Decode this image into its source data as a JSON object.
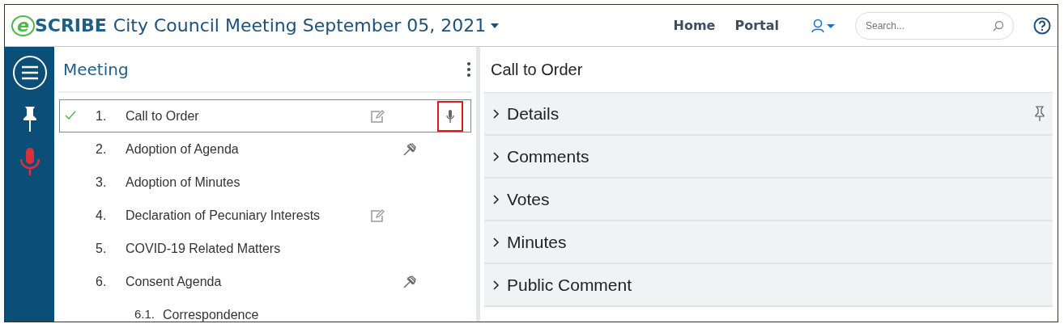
{
  "header": {
    "logo_mark": "e",
    "logo_text": "SCRIBE",
    "title": "City Council Meeting September 05, 2021",
    "nav": [
      "Home",
      "Portal"
    ],
    "search": {
      "placeholder": "Search..."
    }
  },
  "sidebar": {
    "items": [
      {
        "kind": "menu"
      },
      {
        "kind": "pin"
      },
      {
        "kind": "mic"
      }
    ]
  },
  "agenda": {
    "title": "Meeting",
    "items": [
      {
        "number": "1.",
        "title": "Call to Order",
        "checked": true,
        "selected": true,
        "notes": true,
        "motion": false,
        "recording": true
      },
      {
        "number": "2.",
        "title": "Adoption of Agenda",
        "checked": false,
        "selected": false,
        "notes": false,
        "motion": true,
        "recording": false
      },
      {
        "number": "3.",
        "title": "Adoption of Minutes",
        "checked": false,
        "selected": false,
        "notes": false,
        "motion": false,
        "recording": false
      },
      {
        "number": "4.",
        "title": "Declaration of Pecuniary Interests",
        "checked": false,
        "selected": false,
        "notes": true,
        "motion": false,
        "recording": false
      },
      {
        "number": "5.",
        "title": "COVID-19 Related Matters",
        "checked": false,
        "selected": false,
        "notes": false,
        "motion": false,
        "recording": false
      },
      {
        "number": "6.",
        "title": "Consent Agenda",
        "checked": false,
        "selected": false,
        "notes": false,
        "motion": true,
        "recording": false,
        "children": [
          {
            "number": "6.1.",
            "title": "Correspondence",
            "selected": false
          }
        ]
      }
    ]
  },
  "detail": {
    "title": "Call to Order",
    "sections": [
      {
        "label": "Details",
        "expanded": false,
        "pinned": true
      },
      {
        "label": "Comments",
        "expanded": false,
        "pinned": false
      },
      {
        "label": "Votes",
        "expanded": false,
        "pinned": false
      },
      {
        "label": "Minutes",
        "expanded": false,
        "pinned": false
      },
      {
        "label": "Public Comment",
        "expanded": false,
        "pinned": false
      }
    ]
  }
}
